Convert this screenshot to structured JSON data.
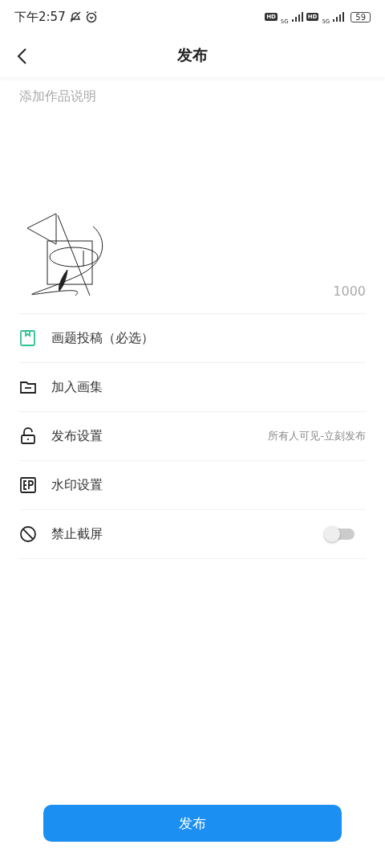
{
  "status_bar": {
    "time": "下午2:57",
    "sims": [
      {
        "badge": "HD",
        "network": "5G"
      },
      {
        "badge": "HD",
        "network": "5G"
      }
    ],
    "battery": "59"
  },
  "header": {
    "title": "发布"
  },
  "description": {
    "placeholder": "添加作品说明",
    "counter": "1000"
  },
  "rows": [
    {
      "kind": "link",
      "label": "画题投稿（必选）",
      "color": "#2ec28f"
    },
    {
      "kind": "link",
      "label": "加入画集",
      "color": "#222222"
    },
    {
      "kind": "link",
      "label": "发布设置",
      "value": "所有人可见-立刻发布",
      "color": "#222222"
    },
    {
      "kind": "link",
      "label": "水印设置",
      "color": "#222222"
    },
    {
      "kind": "toggle",
      "label": "禁止截屏",
      "on": false,
      "color": "#222222"
    }
  ],
  "submit_button": "发布"
}
